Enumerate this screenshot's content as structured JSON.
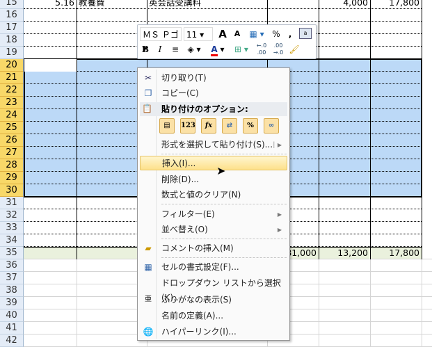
{
  "rows": [
    {
      "num": "15",
      "a": "5.16",
      "b": "教養費",
      "c": "英会話受講料",
      "d": "",
      "e": "4,000",
      "f": "17,800"
    },
    {
      "num": "16"
    },
    {
      "num": "17"
    },
    {
      "num": "18"
    },
    {
      "num": "19"
    },
    {
      "num": "20"
    },
    {
      "num": "21"
    },
    {
      "num": "22"
    },
    {
      "num": "23"
    },
    {
      "num": "24"
    },
    {
      "num": "25"
    },
    {
      "num": "26"
    },
    {
      "num": "27"
    },
    {
      "num": "28"
    },
    {
      "num": "29"
    },
    {
      "num": "30"
    },
    {
      "num": "31"
    },
    {
      "num": "32"
    },
    {
      "num": "33"
    },
    {
      "num": "34"
    },
    {
      "num": "35",
      "d": "81,000",
      "e": "13,200",
      "f": "17,800"
    },
    {
      "num": "36"
    },
    {
      "num": "37"
    },
    {
      "num": "38"
    },
    {
      "num": "39"
    },
    {
      "num": "40"
    },
    {
      "num": "41"
    },
    {
      "num": "42"
    }
  ],
  "mini_toolbar": {
    "font": "ＭＳ Ｐゴ",
    "size": "11",
    "grow": "A",
    "shrink": "A",
    "percent": "%",
    "comma": ",",
    "bold": "B",
    "italic": "I",
    "font_color": "A",
    "dec_inc": "←.0 .00",
    "dec_dec": ".00 →.0"
  },
  "menu": {
    "cut": "切り取り(T)",
    "copy": "コピー(C)",
    "paste_header": "貼り付けのオプション:",
    "paste_icons": [
      "paste",
      "123",
      "fx",
      "transpose",
      "%",
      "link"
    ],
    "paste_special": "形式を選択して貼り付け(S)...",
    "insert": "挿入(I)...",
    "delete": "削除(D)...",
    "clear": "数式と値のクリア(N)",
    "filter": "フィルター(E)",
    "sort": "並べ替え(O)",
    "comment": "コメントの挿入(M)",
    "format": "セルの書式設定(F)...",
    "dropdown": "ドロップダウン リストから選択(K)...",
    "furigana": "ふりがなの表示(S)",
    "name": "名前の定義(A)...",
    "hyperlink": "ハイパーリンク(I)..."
  },
  "colors": {
    "selection": "#bcd9f7",
    "header_sel": "#f8d868",
    "total_row": "#eaf1dd"
  }
}
